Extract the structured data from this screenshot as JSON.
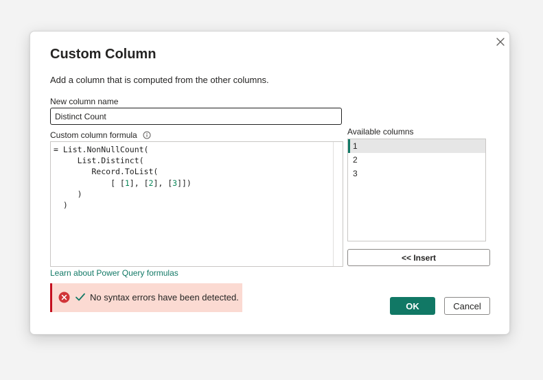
{
  "dialog": {
    "title": "Custom Column",
    "description": "Add a column that is computed from the other columns.",
    "close_icon": "close-icon"
  },
  "name_field": {
    "label": "New column name",
    "value": "Distinct Count"
  },
  "formula": {
    "label": "Custom column formula",
    "info_icon": "info-icon",
    "lines": [
      "= List.NonNullCount(",
      "     List.Distinct(",
      "        Record.ToList(",
      "            [ [1], [2], [3]])",
      "     )",
      "  )"
    ],
    "text_color": "#1f1f1f",
    "number_color": "#098658"
  },
  "available_columns": {
    "label": "Available columns",
    "items": [
      "1",
      "2",
      "3"
    ],
    "selected": "1"
  },
  "insert_button": {
    "label": "<< Insert"
  },
  "learn_link": {
    "label": "Learn about Power Query formulas"
  },
  "status": {
    "text": "No syntax errors have been detected.",
    "error_icon": "error-circle-icon",
    "check_icon": "checkmark-icon",
    "background": "#fbdad2",
    "accent": "#c50f1f"
  },
  "ok_button": {
    "label": "OK"
  },
  "cancel_button": {
    "label": "Cancel"
  },
  "colors": {
    "accent": "#117865",
    "text": "#252423"
  }
}
